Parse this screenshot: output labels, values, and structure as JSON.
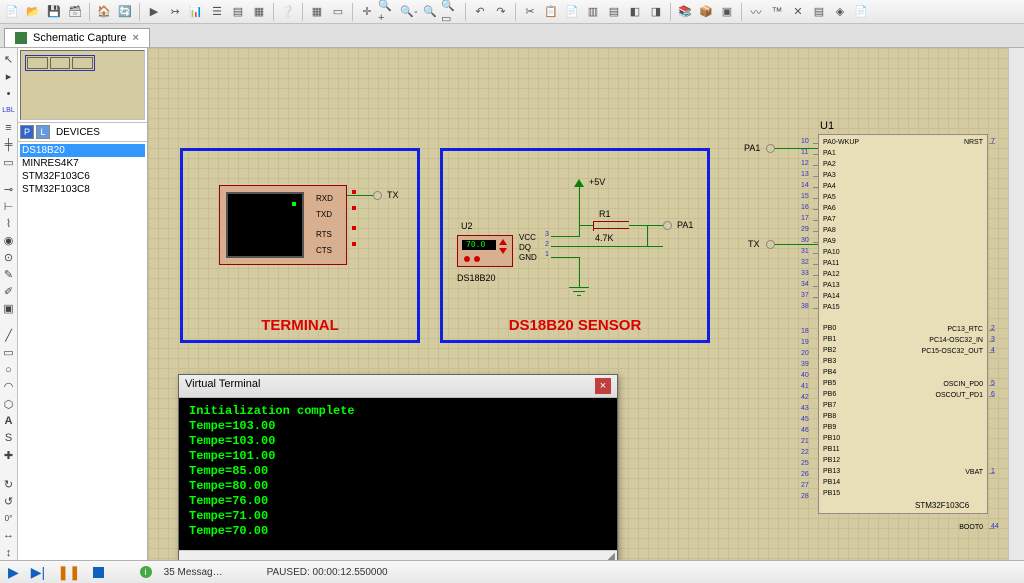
{
  "tab": {
    "title": "Schematic Capture",
    "close": "×"
  },
  "devicePanel": {
    "header": "DEVICES",
    "items": [
      "DS18B20",
      "MINRES4K7",
      "STM32F103C6",
      "STM32F103C8"
    ]
  },
  "terminalBox": {
    "label": "TERMINAL",
    "pins": [
      "RXD",
      "TXD",
      "RTS",
      "CTS"
    ],
    "net": "TX"
  },
  "sensorBox": {
    "label": "DS18B20 SENSOR",
    "chipRef": "U2",
    "chipPart": "DS18B20",
    "chipDisplay": "70.0",
    "chipPins": [
      "VCC",
      "DQ",
      "GND"
    ],
    "chipPinNums": [
      "3",
      "2",
      "1"
    ],
    "resRef": "R1",
    "resVal": "4.7K",
    "vccLabel": "+5V",
    "net": "PA1"
  },
  "mcu": {
    "ref": "U1",
    "part": "STM32F103C6",
    "leftPinsTop": [
      "PA0-WKUP",
      "PA1",
      "PA2",
      "PA3",
      "PA4",
      "PA5",
      "PA6",
      "PA7",
      "PA8",
      "PA9",
      "PA10",
      "PA11",
      "PA12",
      "PA13",
      "PA14",
      "PA15"
    ],
    "leftNumsTop": [
      "10",
      "11",
      "12",
      "13",
      "14",
      "15",
      "16",
      "17",
      "29",
      "30",
      "31",
      "32",
      "33",
      "34",
      "37",
      "38"
    ],
    "leftPinsBot": [
      "PB0",
      "PB1",
      "PB2",
      "PB3",
      "PB4",
      "PB5",
      "PB6",
      "PB7",
      "PB8",
      "PB9",
      "PB10",
      "PB11",
      "PB12",
      "PB13",
      "PB14",
      "PB15"
    ],
    "leftNumsBot": [
      "18",
      "19",
      "20",
      "39",
      "40",
      "41",
      "42",
      "43",
      "45",
      "46",
      "21",
      "22",
      "25",
      "26",
      "27",
      "28"
    ],
    "rightPins": [
      "NRST",
      "PC13_RTC",
      "PC14-OSC32_IN",
      "PC15-OSC32_OUT",
      "OSCIN_PD0",
      "OSCOUT_PD1",
      "VBAT",
      "BOOT0"
    ],
    "rightNums": [
      "7",
      "2",
      "3",
      "4",
      "5",
      "6",
      "1",
      "44"
    ],
    "netPA1": "PA1",
    "netTX": "TX"
  },
  "virtualTerminal": {
    "title": "Virtual Terminal",
    "lines": [
      "Initialization complete",
      "Tempe=103.00",
      "Tempe=103.00",
      "Tempe=101.00",
      "Tempe=85.00",
      "Tempe=80.00",
      "Tempe=76.00",
      "Tempe=71.00",
      "Tempe=70.00"
    ]
  },
  "statusBar": {
    "messages": "35 Messag…",
    "paused": "PAUSED: 00:00:12.550000"
  }
}
